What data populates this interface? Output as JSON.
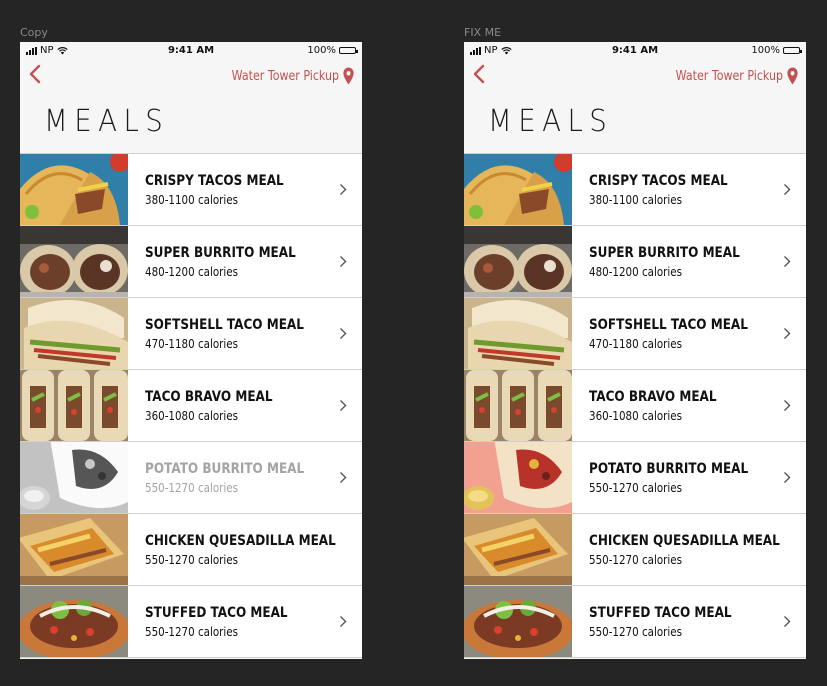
{
  "colors": {
    "accent": "#c2524f",
    "canvas": "#252525"
  },
  "artboards": [
    {
      "label": "Copy",
      "status": {
        "carrier": "NP",
        "time": "9:41 AM",
        "battery": "100%"
      },
      "nav": {
        "back_icon": "chevron-left-icon",
        "pickup_label": "Water Tower Pickup",
        "pickup_icon": "map-pin-icon"
      },
      "title": "MEALS",
      "meals": [
        {
          "name": "CRISPY TACOS MEAL",
          "calories": "380-1100 calories",
          "disabled": false,
          "photo": "crispy-tacos"
        },
        {
          "name": "SUPER BURRITO MEAL",
          "calories": "480-1200 calories",
          "disabled": false,
          "photo": "burrito"
        },
        {
          "name": "SOFTSHELL TACO MEAL",
          "calories": "470-1180 calories",
          "disabled": false,
          "photo": "softshell"
        },
        {
          "name": "TACO BRAVO MEAL",
          "calories": "360-1080 calories",
          "disabled": false,
          "photo": "bravo"
        },
        {
          "name": "POTATO BURRITO MEAL",
          "calories": "550-1270 calories",
          "disabled": true,
          "photo": "potato"
        },
        {
          "name": "CHICKEN QUESADILLA MEAL",
          "calories": "550-1270 calories",
          "disabled": false,
          "photo": "quesadilla"
        },
        {
          "name": "STUFFED TACO MEAL",
          "calories": "550-1270 calories",
          "disabled": false,
          "photo": "stuffed"
        }
      ]
    },
    {
      "label": "FIX ME",
      "status": {
        "carrier": "NP",
        "time": "9:41 AM",
        "battery": "100%"
      },
      "nav": {
        "back_icon": "chevron-left-icon",
        "pickup_label": "Water Tower Pickup",
        "pickup_icon": "map-pin-icon"
      },
      "title": "MEALS",
      "meals": [
        {
          "name": "CRISPY TACOS MEAL",
          "calories": "380-1100 calories",
          "disabled": false,
          "photo": "crispy-tacos"
        },
        {
          "name": "SUPER BURRITO MEAL",
          "calories": "480-1200 calories",
          "disabled": false,
          "photo": "burrito"
        },
        {
          "name": "SOFTSHELL TACO MEAL",
          "calories": "470-1180 calories",
          "disabled": false,
          "photo": "softshell"
        },
        {
          "name": "TACO BRAVO MEAL",
          "calories": "360-1080 calories",
          "disabled": false,
          "photo": "bravo"
        },
        {
          "name": "POTATO BURRITO MEAL",
          "calories": "550-1270 calories",
          "disabled": false,
          "photo": "potato"
        },
        {
          "name": "CHICKEN QUESADILLA MEAL",
          "calories": "550-1270 calories",
          "disabled": false,
          "photo": "quesadilla"
        },
        {
          "name": "STUFFED TACO MEAL",
          "calories": "550-1270 calories",
          "disabled": false,
          "photo": "stuffed"
        }
      ]
    }
  ]
}
